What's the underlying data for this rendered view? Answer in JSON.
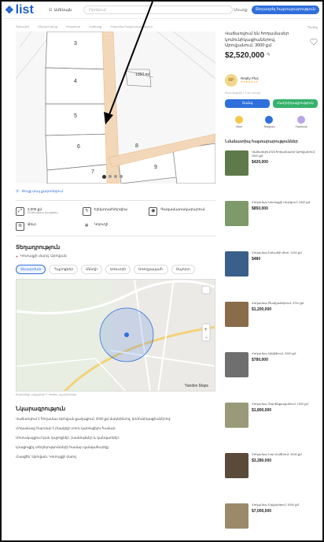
{
  "header": {
    "logo_text": "list",
    "category_label": "Ամենայն",
    "search_placeholder": "Որոնում",
    "login_label": "Մուտք",
    "post_button": "Տեղադրել հայտարարություն"
  },
  "breadcrumbs": [
    "Գլխավոր",
    "Անշարժ գույք",
    "Հողամաս",
    "Վաճառք",
    "Հողամաս հայտարարություն"
  ],
  "fav_top": "Պահել",
  "plan": {
    "plots": [
      "3",
      "4",
      "5",
      "6",
      "7",
      "8",
      "9"
    ],
    "area_label": "1350 m²",
    "page_dots": 4
  },
  "main": {
    "map_link": "Ցույց տալ քարտեզում",
    "features": [
      {
        "icon": "area-icon",
        "label": "3,000 քմ",
        "sub": "Ընդհանուր մակերես"
      },
      {
        "icon": "electricity-icon",
        "label": "Էլեկտրաէներգիա",
        "sub": ""
      },
      {
        "icon": "gas-icon",
        "label": "Գազամատակարարում",
        "sub": ""
      },
      {
        "icon": "water-icon",
        "label": "Ջուր",
        "sub": ""
      },
      {
        "icon": "sewer-icon",
        "label": "Կոյուղի",
        "sub": ""
      }
    ],
    "location_title": "Տեղադրություն",
    "address": "Կոտայքի մարզ, Աբովյան",
    "tabs": [
      "Տեսարժան",
      "Դպրոցներ",
      "Սննդի",
      "Առևտրի",
      "Առողջապահ.",
      "Սպորտ"
    ],
    "map_foot": "Քարտեզի տվյալներ © Yandex, պայմաններ",
    "map_brand": "Yandex Maps",
    "desc_title": "Նկարագրություն",
    "desc": [
      "Վաճառվում է հողամաս Աբովյան քաղաքում, 3000 քմ մակերեսով, կոմունիկացիաներով:",
      "Հողամասը հարմար է բնակելի տուն կառուցելու համար:",
      "Մոտակայքում կան դպրոցներ, խանութներ և կանգառներ:",
      "Լրացուցիչ տեղեկությունների համար զանգահարեք:",
      "Հասցեն՝ Աբովյան, Կոտայքի մարզ"
    ]
  },
  "side": {
    "title": "Վաճառվում են հողամասեր կոմունիկացիաներով, Աբովյանում, 3000 քմ",
    "price": "$2,520,000",
    "currency": "֏",
    "seller_name": "Realty Plus",
    "seller_rating": "★★★★★ 4.8",
    "meta": "Թարմացվել է 2 օր առաջ",
    "btn_call": "Զանգ",
    "btn_message": "Հաղորդագրություն",
    "share": [
      "Viber",
      "Telegram",
      "Facebook"
    ],
    "similar_title": "Նմանատիպ հայտարարություններ",
    "similar": [
      {
        "text": "Վաճառվում են հողամասեր Աբովյանում, 2500 քմ",
        "price": "$420,000",
        "color": "#5e7a4a"
      },
      {
        "text": "Հողամաս Կոտայքի մարզում, 1800 քմ",
        "price": "$850,000",
        "color": "#7f9a6a"
      },
      {
        "text": "Հողամաս Երևանի մոտ, 1200 քմ",
        "price": "$480",
        "color": "#3a5f8a"
      },
      {
        "text": "Հողամաս Ծաղկաձորում, 3700 քմ",
        "price": "$1,200,000",
        "color": "#8a6b4a"
      },
      {
        "text": "Հողամաս Արզնիում, 2000 քմ",
        "price": "$780,000",
        "color": "#6f6f6f"
      },
      {
        "text": "Հողամաս Չարենցավանում, 1500 քմ",
        "price": "$1,800,000",
        "color": "#9a9a7a"
      },
      {
        "text": "Հողամաս Նոր Հաճնում, 3000 քմ",
        "price": "$3,280,000",
        "color": "#5a4a3a"
      },
      {
        "text": "Հողամաս Եղվարդում, 5000 քմ",
        "price": "$7,000,000",
        "color": "#9a8a6a"
      }
    ]
  }
}
